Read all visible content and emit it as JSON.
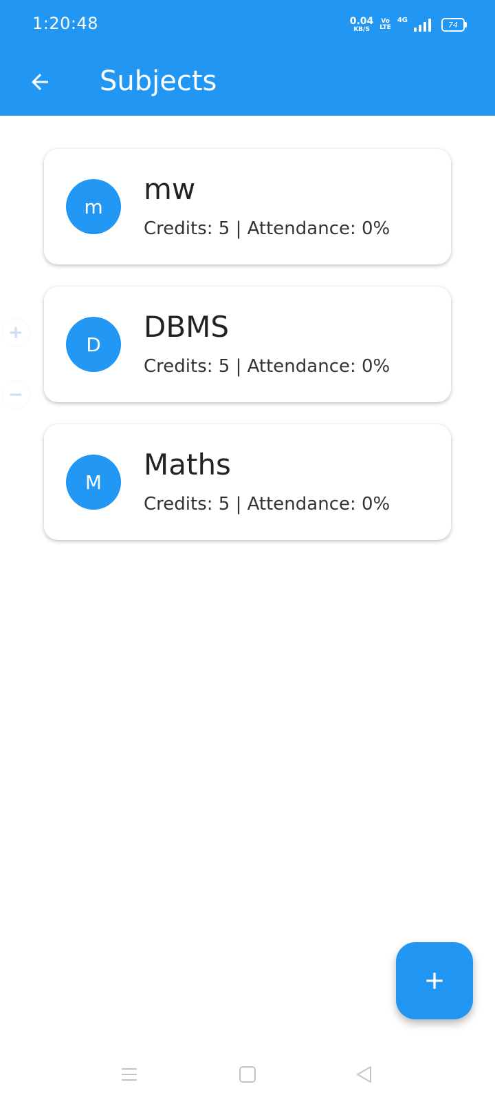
{
  "status_bar": {
    "time": "1:20:48",
    "net_speed_value": "0.04",
    "net_speed_unit": "KB/S",
    "volte_top": "Vo",
    "volte_bottom": "LTE",
    "network_type": "4G",
    "battery_level": "74"
  },
  "app_bar": {
    "title": "Subjects",
    "back_icon": "arrow-left-icon"
  },
  "subjects": [
    {
      "initial": "m",
      "name": "mw",
      "meta": "Credits: 5 | Attendance: 0%"
    },
    {
      "initial": "D",
      "name": "DBMS",
      "meta": "Credits: 5 | Attendance: 0%"
    },
    {
      "initial": "M",
      "name": "Maths",
      "meta": "Credits: 5 | Attendance: 0%"
    }
  ],
  "zoom_controls": {
    "in_label": "+",
    "out_label": "−"
  },
  "fab": {
    "icon": "plus-icon"
  },
  "nav_bar": {
    "icons": [
      "menu-icon",
      "home-square-icon",
      "back-triangle-icon"
    ]
  },
  "colors": {
    "primary": "#2196F3",
    "on_primary": "#FFFFFF",
    "text": "#222222"
  }
}
